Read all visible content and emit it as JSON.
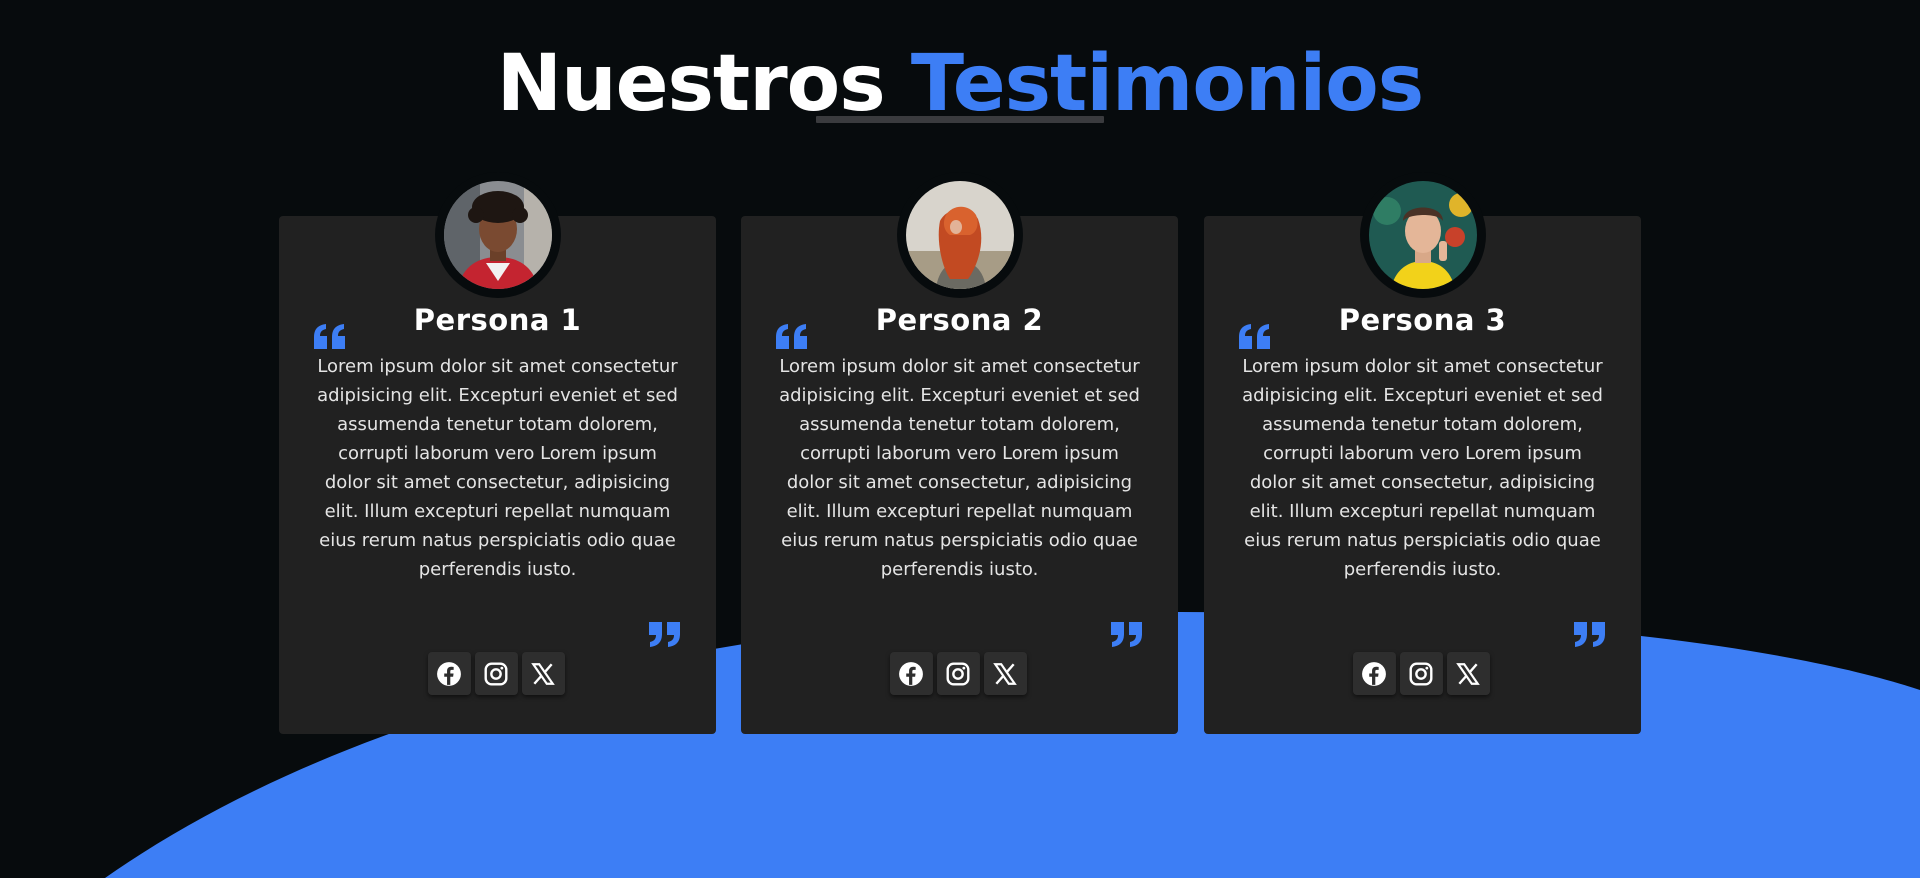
{
  "heading": {
    "part1": "Nuestros",
    "part2": "Testimonios"
  },
  "colors": {
    "accent": "#3d7ef5",
    "background": "#070b0d",
    "card": "#212121",
    "social_button": "#2e2e2e"
  },
  "testimonials": [
    {
      "name": "Persona 1",
      "text": "Lorem ipsum dolor sit amet consectetur adipisicing elit. Excepturi eveniet et sed assumenda tenetur totam dolorem, corrupti laborum vero Lorem ipsum dolor sit amet consectetur, adipisicing elit. Illum excepturi repellat numquam eius rerum natus perspiciatis odio quae perferendis iusto.",
      "socials": [
        "facebook-icon",
        "instagram-icon",
        "x-icon"
      ]
    },
    {
      "name": "Persona 2",
      "text": "Lorem ipsum dolor sit amet consectetur adipisicing elit. Excepturi eveniet et sed assumenda tenetur totam dolorem, corrupti laborum vero Lorem ipsum dolor sit amet consectetur, adipisicing elit. Illum excepturi repellat numquam eius rerum natus perspiciatis odio quae perferendis iusto.",
      "socials": [
        "facebook-icon",
        "instagram-icon",
        "x-icon"
      ]
    },
    {
      "name": "Persona 3",
      "text": "Lorem ipsum dolor sit amet consectetur adipisicing elit. Excepturi eveniet et sed assumenda tenetur totam dolorem, corrupti laborum vero Lorem ipsum dolor sit amet consectetur, adipisicing elit. Illum excepturi repellat numquam eius rerum natus perspiciatis odio quae perferendis iusto.",
      "socials": [
        "facebook-icon",
        "instagram-icon",
        "x-icon"
      ]
    }
  ]
}
